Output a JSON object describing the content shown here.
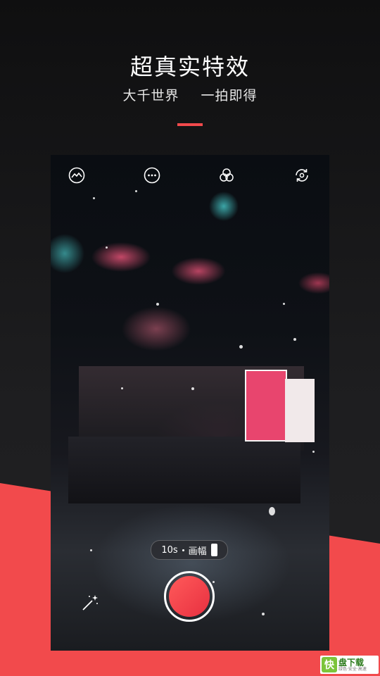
{
  "header": {
    "title": "超真实特效",
    "subtitle_left": "大千世界",
    "subtitle_right": "一拍即得"
  },
  "camera": {
    "toolbar": [
      {
        "name": "gallery-icon"
      },
      {
        "name": "more-icon"
      },
      {
        "name": "filter-icon"
      },
      {
        "name": "switch-camera-icon"
      }
    ],
    "duration_label": "10s",
    "aspect_label": "画幅",
    "magic_icon": "magic-wand-icon",
    "shutter_color": "#f24a4c"
  },
  "watermark": {
    "logo_char": "快",
    "title": "盘下载",
    "tagline": "绿色·安全·高速"
  },
  "colors": {
    "accent": "#f24a4c",
    "background": "#1c1c1e"
  }
}
